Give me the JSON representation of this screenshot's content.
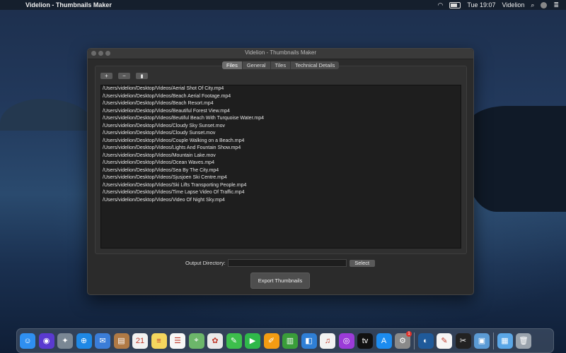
{
  "menubar": {
    "apple_glyph": "",
    "app_name": "Videlion - Thumbnails Maker",
    "clock": "Tue 19:07",
    "user": "Videlion",
    "icons": [
      "wifi-icon",
      "battery-icon",
      "control-center-icon",
      "avatar-icon",
      "spotlight-icon"
    ]
  },
  "window": {
    "title": "Videlion - Thumbnails Maker",
    "tabs": [
      {
        "label": "Files",
        "active": true
      },
      {
        "label": "General",
        "active": false
      },
      {
        "label": "Tiles",
        "active": false
      },
      {
        "label": "Technical Details",
        "active": false
      }
    ],
    "toolbar": {
      "add_label": "+",
      "remove_label": "−",
      "trash_icon": "trash-icon"
    },
    "files": [
      "/Users/videlion/Desktop/Videos/Aerial Shot Of City.mp4",
      "/Users/videlion/Desktop/Videos/Beach Aerial Footage.mp4",
      "/Users/videlion/Desktop/Videos/Beach Resort.mp4",
      "/Users/videlion/Desktop/Videos/Beautiful Forest View.mp4",
      "/Users/videlion/Desktop/Videos/Beutiful Beach With Turquoise Water.mp4",
      "/Users/videlion/Desktop/Videos/Cloudy Sky Sunset.mov",
      "/Users/videlion/Desktop/Videos/Cloudy Sunset.mov",
      "/Users/videlion/Desktop/Videos/Couple Walking on a Beach.mp4",
      "/Users/videlion/Desktop/Videos/Lights And Fountain Show.mp4",
      "/Users/videlion/Desktop/Videos/Mountain Lake.mov",
      "/Users/videlion/Desktop/Videos/Ocean Waves.mp4",
      "/Users/videlion/Desktop/Videos/Sea By The City.mp4",
      "/Users/videlion/Desktop/Videos/Sjusjoen Ski Centre.mp4",
      "/Users/videlion/Desktop/Videos/Ski Lifts Transporting People.mp4",
      "/Users/videlion/Desktop/Videos/Time Lapse Video Of Traffic.mp4",
      "/Users/videlion/Desktop/Videos/Video Of Night Sky.mp4"
    ],
    "output": {
      "label": "Output Directory:",
      "value": "",
      "select_label": "Select"
    },
    "export_label": "Export Thumbnails"
  },
  "dock": {
    "apps": [
      {
        "name": "finder-icon",
        "glyph": "☺",
        "color": "#2f8ff0"
      },
      {
        "name": "siri-icon",
        "glyph": "◉",
        "color": "#5a3ad0"
      },
      {
        "name": "launchpad-icon",
        "glyph": "✦",
        "color": "#7a8794"
      },
      {
        "name": "safari-icon",
        "glyph": "⊕",
        "color": "#1e88e5"
      },
      {
        "name": "mail-icon",
        "glyph": "✉",
        "color": "#3b7dd8"
      },
      {
        "name": "contacts-icon",
        "glyph": "▤",
        "color": "#b07a45"
      },
      {
        "name": "calendar-icon",
        "glyph": "21",
        "color": "#f2f2f2"
      },
      {
        "name": "notes-icon",
        "glyph": "≡",
        "color": "#f4d65e"
      },
      {
        "name": "reminders-icon",
        "glyph": "☰",
        "color": "#f7f7f7"
      },
      {
        "name": "maps-icon",
        "glyph": "⌖",
        "color": "#6cb66a"
      },
      {
        "name": "photos-icon",
        "glyph": "✿",
        "color": "#e9e9e9"
      },
      {
        "name": "messages-icon",
        "glyph": "✎",
        "color": "#3dbf4c"
      },
      {
        "name": "facetime-icon",
        "glyph": "▶",
        "color": "#2fb84a"
      },
      {
        "name": "pages-icon",
        "glyph": "✐",
        "color": "#f39c12"
      },
      {
        "name": "numbers-icon",
        "glyph": "▥",
        "color": "#3a9d3a"
      },
      {
        "name": "keynote-icon",
        "glyph": "◧",
        "color": "#2f7fd6"
      },
      {
        "name": "music-icon",
        "glyph": "♫",
        "color": "#f2f2f2"
      },
      {
        "name": "podcasts-icon",
        "glyph": "◎",
        "color": "#9b3bd8"
      },
      {
        "name": "tv-icon",
        "glyph": "tv",
        "color": "#111111"
      },
      {
        "name": "app-store-icon",
        "glyph": "A",
        "color": "#1c8cf0"
      },
      {
        "name": "system-preferences-icon",
        "glyph": "⚙",
        "color": "#8a8a8a",
        "badge": "1"
      }
    ],
    "recent": [
      {
        "name": "videlion-icon",
        "glyph": "◐",
        "color": "#1f5a9a"
      },
      {
        "name": "textedit-icon",
        "glyph": "✎",
        "color": "#f5f5f5"
      },
      {
        "name": "screenshot-icon",
        "glyph": "✂",
        "color": "#222222"
      },
      {
        "name": "preview-icon",
        "glyph": "▣",
        "color": "#5b9bd5"
      }
    ],
    "folders": [
      {
        "name": "downloads-folder-icon",
        "glyph": "▦",
        "color": "#5aa6e6"
      },
      {
        "name": "trash-icon",
        "glyph": "🗑",
        "color": "#9aa3ad"
      }
    ]
  }
}
